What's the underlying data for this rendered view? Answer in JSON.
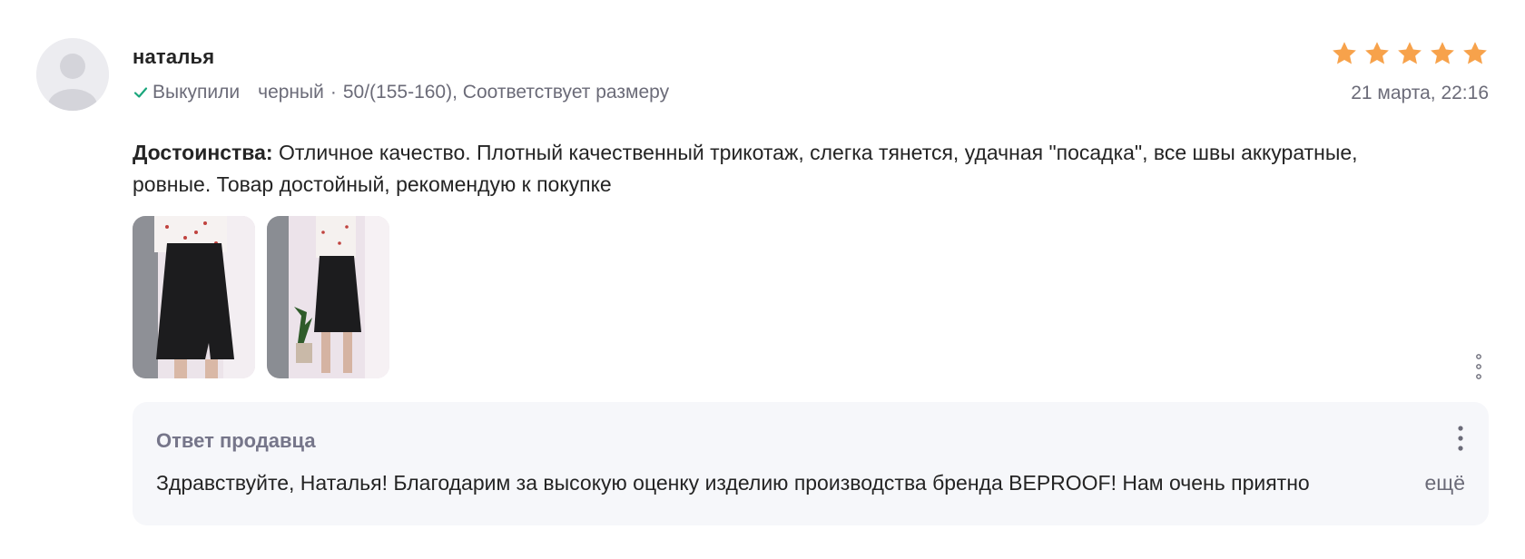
{
  "review": {
    "author": "наталья",
    "purchased_label": "Выкупили",
    "variant_color": "черный",
    "meta_separator": "·",
    "variant_details": "50/(155-160), Соответствует размеру",
    "date": "21 марта, 22:16",
    "rating": 5,
    "rating_max": 5,
    "star_color": "#f7a24b",
    "check_color": "#1aa67c",
    "pros_label": "Достоинства:",
    "pros_text": "Отличное качество. Плотный качественный трикотаж, слегка тянется, удачная \"посадка\", все швы аккуратные, ровные. Товар достойный, рекомендую к покупке",
    "photos": [
      {
        "icon": "skirt-photo-1"
      },
      {
        "icon": "skirt-photo-2"
      }
    ],
    "more_icon": "more-vertical-icon"
  },
  "seller_reply": {
    "title": "Ответ продавца",
    "text": "Здравствуйте, Наталья! Благодарим за высокую оценку изделию производства бренда BEPROOF! Нам очень приятно",
    "expand_label": "ещё",
    "background": "#f6f7fa"
  }
}
